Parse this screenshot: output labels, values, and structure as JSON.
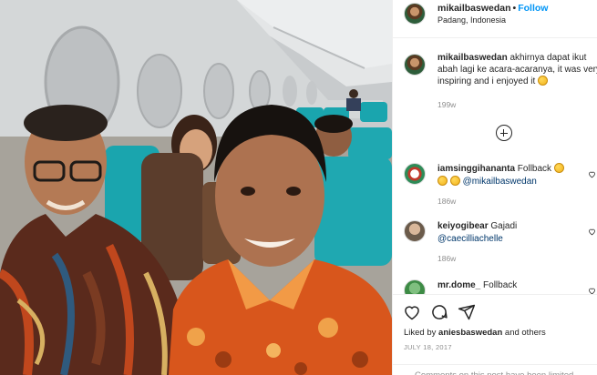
{
  "post": {
    "username": "mikailbaswedan",
    "dot": "•",
    "follow_label": "Follow",
    "location": "Padang, Indonesia",
    "image_alt": "Selfie of two people seated in an airplane cabin"
  },
  "caption": {
    "username": "mikailbaswedan",
    "text": "akhirnya dapat ikut abah lagi ke acara-acaranya, it was very inspiring and i enjoyed it",
    "time": "199w"
  },
  "comments": [
    {
      "username": "iamsinggihananta",
      "text": "Follback",
      "mention": "@mikailbaswedan",
      "time": "186w",
      "avatar_color": "#c0392b"
    },
    {
      "username": "keiyogibear",
      "text": "Gajadi",
      "mention": "@caecilliachelle",
      "time": "186w",
      "avatar_color": "#6b5b4b"
    },
    {
      "username": "mr.dome_",
      "text": "Follback",
      "mention": "",
      "time": "",
      "avatar_color": "#3d8b45"
    }
  ],
  "actions": {
    "like_icon": "heart-icon",
    "comment_icon": "comment-icon",
    "share_icon": "share-icon",
    "liked_by_prefix": "Liked by",
    "liked_by_user": "aniesbaswedan",
    "liked_by_suffix": "and others",
    "date": "JULY 18, 2017",
    "comments_limited": "Comments on this post have been limited."
  },
  "colors": {
    "follow": "#0095f6",
    "muted": "#8e8e8e",
    "mention": "#00376b",
    "seat_teal": "#1aa5ae",
    "batik_red": "#c0471d"
  }
}
